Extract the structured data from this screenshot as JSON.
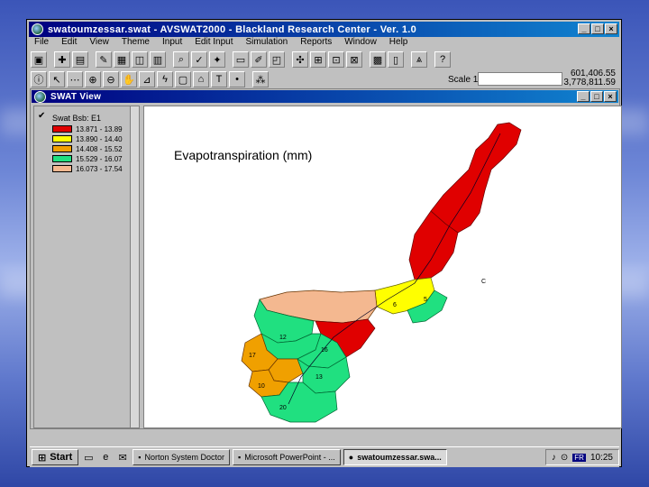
{
  "app": {
    "title": "swatoumzessar.swat - AVSWAT2000 - Blackland Research Center - Ver. 1.0",
    "window_buttons": [
      "_",
      "□",
      "×"
    ],
    "menu": [
      "File",
      "Edit",
      "View",
      "Theme",
      "Input",
      "Edit Input",
      "Simulation",
      "Reports",
      "Window",
      "Help"
    ],
    "scale_label": "Scale 1:",
    "coords": [
      "601,406.55",
      "3,778,811.59"
    ]
  },
  "view": {
    "title": "SWAT View",
    "window_buttons": [
      "_",
      "□",
      "×"
    ],
    "toc": {
      "theme_name": "Swat Bsb: E1",
      "legend": [
        {
          "label": "13.871 - 13.89",
          "color": "#e00000"
        },
        {
          "label": "13.890 - 14.40",
          "color": "#ffff00"
        },
        {
          "label": "14.408 - 15.52",
          "color": "#f0a000"
        },
        {
          "label": "15.529 - 16.07",
          "color": "#20e080"
        },
        {
          "label": "16.073 - 17.54",
          "color": "#f4b890"
        }
      ]
    },
    "map": {
      "title": "Evapotranspiration (mm)",
      "subbasin_labels": [
        "C",
        "6",
        "5",
        "12",
        "17",
        "16",
        "13",
        "10",
        "20"
      ]
    }
  },
  "taskbar": {
    "start": "Start",
    "tasks": [
      "Norton System Doctor",
      "Microsoft PowerPoint - ...",
      "swatoumzessar.swa..."
    ],
    "clock": "10:25",
    "lang": "FR"
  },
  "icons": [
    "app-icon",
    "save-icon",
    "pointer-icon",
    "zoom-in-icon",
    "zoom-out-icon",
    "pan-icon",
    "text-icon",
    "help-icon"
  ]
}
